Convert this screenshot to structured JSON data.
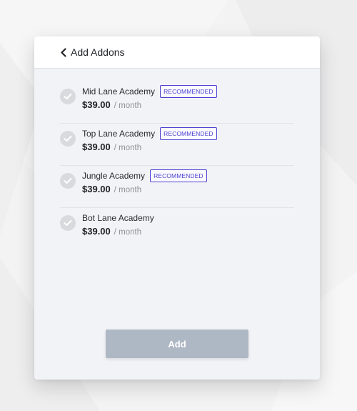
{
  "header": {
    "back_label": "Add Addons"
  },
  "addons": [
    {
      "name": "Mid Lane Academy",
      "badge": "RECOMMENDED",
      "price": "$39.00",
      "period": "/ month"
    },
    {
      "name": "Top Lane Academy",
      "badge": "RECOMMENDED",
      "price": "$39.00",
      "period": "/ month"
    },
    {
      "name": "Jungle Academy",
      "badge": "RECOMMENDED",
      "price": "$39.00",
      "period": "/ month"
    },
    {
      "name": "Bot Lane Academy",
      "badge": "",
      "price": "$39.00",
      "period": "/ month"
    }
  ],
  "actions": {
    "add_label": "Add"
  },
  "icons": {
    "back": "chevron-left-icon",
    "check": "check-circle-icon"
  },
  "colors": {
    "badge": "#4a3fd0",
    "button_disabled": "#aeb7c4",
    "check_inactive": "#d9dadd",
    "panel_bg": "#f2f3f7"
  }
}
